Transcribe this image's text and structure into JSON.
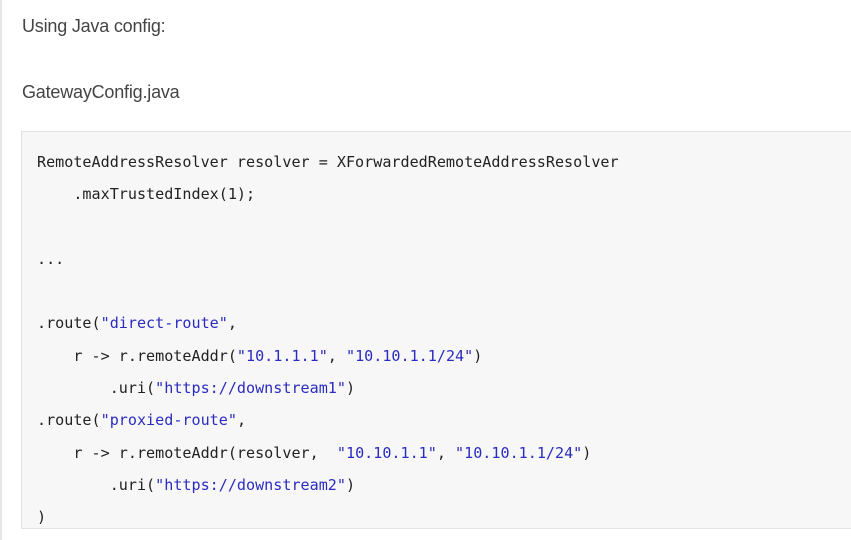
{
  "doc": {
    "intro": "Using Java config:",
    "filename": "GatewayConfig.java"
  },
  "code": {
    "lines": [
      [
        {
          "t": "RemoteAddressResolver resolver = XForwardedRemoteAddressResolver",
          "k": "txt"
        }
      ],
      [
        {
          "t": "    .maxTrustedIndex(1);",
          "k": "txt"
        }
      ],
      [
        {
          "t": "",
          "k": "txt"
        }
      ],
      [
        {
          "t": "...",
          "k": "txt"
        }
      ],
      [
        {
          "t": "",
          "k": "txt"
        }
      ],
      [
        {
          "t": ".route(",
          "k": "txt"
        },
        {
          "t": "\"direct-route\"",
          "k": "str"
        },
        {
          "t": ",",
          "k": "txt"
        }
      ],
      [
        {
          "t": "    r -> r.remoteAddr(",
          "k": "txt"
        },
        {
          "t": "\"10.1.1.1\"",
          "k": "str"
        },
        {
          "t": ", ",
          "k": "txt"
        },
        {
          "t": "\"10.10.1.1/24\"",
          "k": "str"
        },
        {
          "t": ")",
          "k": "txt"
        }
      ],
      [
        {
          "t": "        .uri(",
          "k": "txt"
        },
        {
          "t": "\"https://downstream1\"",
          "k": "str"
        },
        {
          "t": ")",
          "k": "txt"
        }
      ],
      [
        {
          "t": ".route(",
          "k": "txt"
        },
        {
          "t": "\"proxied-route\"",
          "k": "str"
        },
        {
          "t": ",",
          "k": "txt"
        }
      ],
      [
        {
          "t": "    r -> r.remoteAddr(resolver,  ",
          "k": "txt"
        },
        {
          "t": "\"10.10.1.1\"",
          "k": "str"
        },
        {
          "t": ", ",
          "k": "txt"
        },
        {
          "t": "\"10.10.1.1/24\"",
          "k": "str"
        },
        {
          "t": ")",
          "k": "txt"
        }
      ],
      [
        {
          "t": "        .uri(",
          "k": "txt"
        },
        {
          "t": "\"https://downstream2\"",
          "k": "str"
        },
        {
          "t": ")",
          "k": "txt"
        }
      ],
      [
        {
          "t": ")",
          "k": "txt"
        }
      ]
    ]
  },
  "colors": {
    "string": "#2b2bbf",
    "text": "#222222",
    "code_background": "#f7f7f8"
  }
}
